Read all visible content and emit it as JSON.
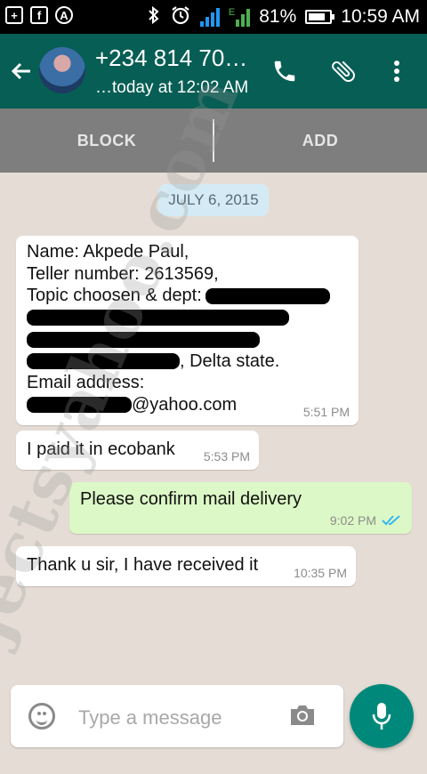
{
  "status_bar": {
    "battery": "81%",
    "battery_level": 0.81,
    "time": "10:59 AM",
    "network_type": "E",
    "icons": [
      "add-box-icon",
      "facebook-icon",
      "app-icon",
      "bluetooth-icon",
      "alarm-icon",
      "signal-icon",
      "battery-icon"
    ]
  },
  "header": {
    "contact_name": "+234 814 70…",
    "last_seen": "…today at 12:02 AM",
    "icons": [
      "back-arrow-icon",
      "avatar",
      "phone-icon",
      "paperclip-icon",
      "more-vert-icon"
    ]
  },
  "actions": {
    "block": "BLOCK",
    "add": "ADD"
  },
  "date_chip": "JULY 6, 2015",
  "messages": [
    {
      "direction": "in",
      "lines": {
        "l1": "Name: Akpede Paul,",
        "l2": "Teller number: 2613569,",
        "l3": "Topic choosen & dept:",
        "l6_tail": ", Delta state.",
        "l7": "Email address:",
        "l8_tail": "@yahoo.com"
      },
      "time": "5:51 PM"
    },
    {
      "direction": "in",
      "text": "I paid it in ecobank",
      "time": "5:53 PM"
    },
    {
      "direction": "out",
      "text": "Please confirm mail delivery",
      "time": "9:02 PM",
      "status": "read"
    },
    {
      "direction": "in",
      "text": "Thank u sir, I have received it",
      "time": "10:35 PM"
    }
  ],
  "watermark": "projectsyahoo.com",
  "composer": {
    "placeholder": "Type a message",
    "icons": [
      "emoji-icon",
      "camera-icon",
      "mic-icon"
    ]
  },
  "colors": {
    "app_bar": "#075e54",
    "action_strip": "#7e7e7e",
    "chat_background": "#e5ddd5",
    "outgoing_bubble": "#dcf8c6",
    "read_ticks": "#34b7f1",
    "fab": "#00897b"
  }
}
